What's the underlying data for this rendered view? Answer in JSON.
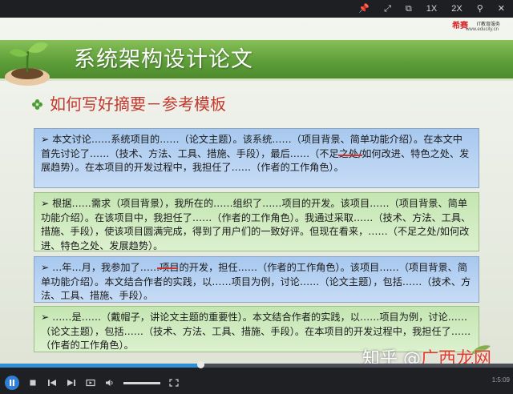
{
  "window": {
    "toolbar_buttons": [
      {
        "label": "📌",
        "icon": "pin-icon"
      },
      {
        "label": "⤢",
        "icon": "expand-icon"
      },
      {
        "label": "⧉",
        "icon": "popout-icon"
      },
      {
        "label": "1X",
        "icon": "speed-1x"
      },
      {
        "label": "2X",
        "icon": "speed-2x"
      },
      {
        "label": "⚲",
        "icon": "search-icon"
      },
      {
        "label": "✕",
        "icon": "close-icon"
      }
    ]
  },
  "logo": {
    "brand": "希赛",
    "tagline": "IT教育服务",
    "url": "www.educity.cn"
  },
  "slide": {
    "title": "系统架构设计论文",
    "subtitle": "如何写好摘要－参考模板",
    "paragraphs": [
      {
        "text": "➢ 本文讨论……系统项目的……（论文主题）。该系统……（项目背景、简单功能介绍）。在本文中首先讨论了……（技术、方法、工具、措施、手段），最后……（不足之处/如何改进、特色之处、发展趋势）。在本项目的开发过程中，我担任了……（作者的工作角色）。",
        "color": "blue"
      },
      {
        "text": "➢ 根据……需求（项目背景），我所在的……组织了……项目的开发。该项目……（项目背景、简单功能介绍）。在该项目中，我担任了……（作者的工作角色）。我通过采取……（技术、方法、工具、措施、手段），使该项目圆满完成，得到了用户们的一致好评。但现在看来，……（不足之处/如何改进、特色之处、发展趋势）。",
        "color": "green"
      },
      {
        "text": "➢ …年…月，我参加了……项目的开发，担任……（作者的工作角色）。该项目……（项目背景、简单功能介绍）。本文结合作者的实践，以……项目为例，讨论……（论文主题），包括……（技术、方法、工具、措施、手段）。",
        "color": "blue"
      },
      {
        "text": "➢ ……是……（戴帽子，讲论文主题的重要性）。本文结合作者的实践，以……项目为例，讨论……（论文主题），包括……（技术、方法、工具、措施、手段）。在本项目的开发过程中，我担任了……（作者的工作角色）。",
        "color": "green"
      }
    ]
  },
  "watermark": {
    "prefix": "知乎 @",
    "highlight": "广西龙网"
  },
  "player": {
    "progress": 0.39,
    "volume": 1.0,
    "time": "1:5:09",
    "controls": [
      {
        "icon": "pause-icon"
      },
      {
        "icon": "stop-icon"
      },
      {
        "icon": "previous-icon"
      },
      {
        "icon": "next-icon"
      },
      {
        "icon": "playlist-icon"
      },
      {
        "icon": "volume-icon"
      },
      {
        "icon": "fullscreen-icon"
      }
    ]
  },
  "colors": {
    "title_band": "#5f9f3a",
    "subtitle": "#c4392d",
    "box_blue": "#b5d1f2",
    "box_green": "#cfeabf",
    "progress": "#2f8fd6"
  }
}
